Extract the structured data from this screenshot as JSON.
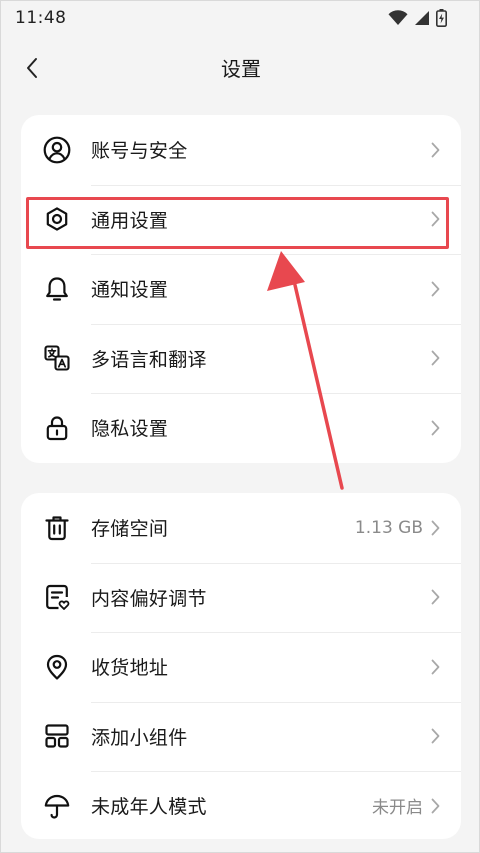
{
  "status_bar": {
    "time": "11:48"
  },
  "header": {
    "title": "设置"
  },
  "groups": [
    {
      "items": [
        {
          "label": "账号与安全",
          "icon": "account-icon"
        },
        {
          "label": "通用设置",
          "icon": "gear-icon"
        },
        {
          "label": "通知设置",
          "icon": "bell-icon"
        },
        {
          "label": "多语言和翻译",
          "icon": "translate-icon"
        },
        {
          "label": "隐私设置",
          "icon": "lock-icon"
        }
      ]
    },
    {
      "items": [
        {
          "label": "存储空间",
          "value": "1.13 GB",
          "icon": "trash-icon"
        },
        {
          "label": "内容偏好调节",
          "icon": "content-preference-icon"
        },
        {
          "label": "收货地址",
          "icon": "location-pin-icon"
        },
        {
          "label": "添加小组件",
          "icon": "widget-icon"
        },
        {
          "label": "未成年人模式",
          "value": "未开启",
          "icon": "umbrella-icon"
        }
      ]
    }
  ],
  "annotation": {
    "color": "#e8484f"
  }
}
